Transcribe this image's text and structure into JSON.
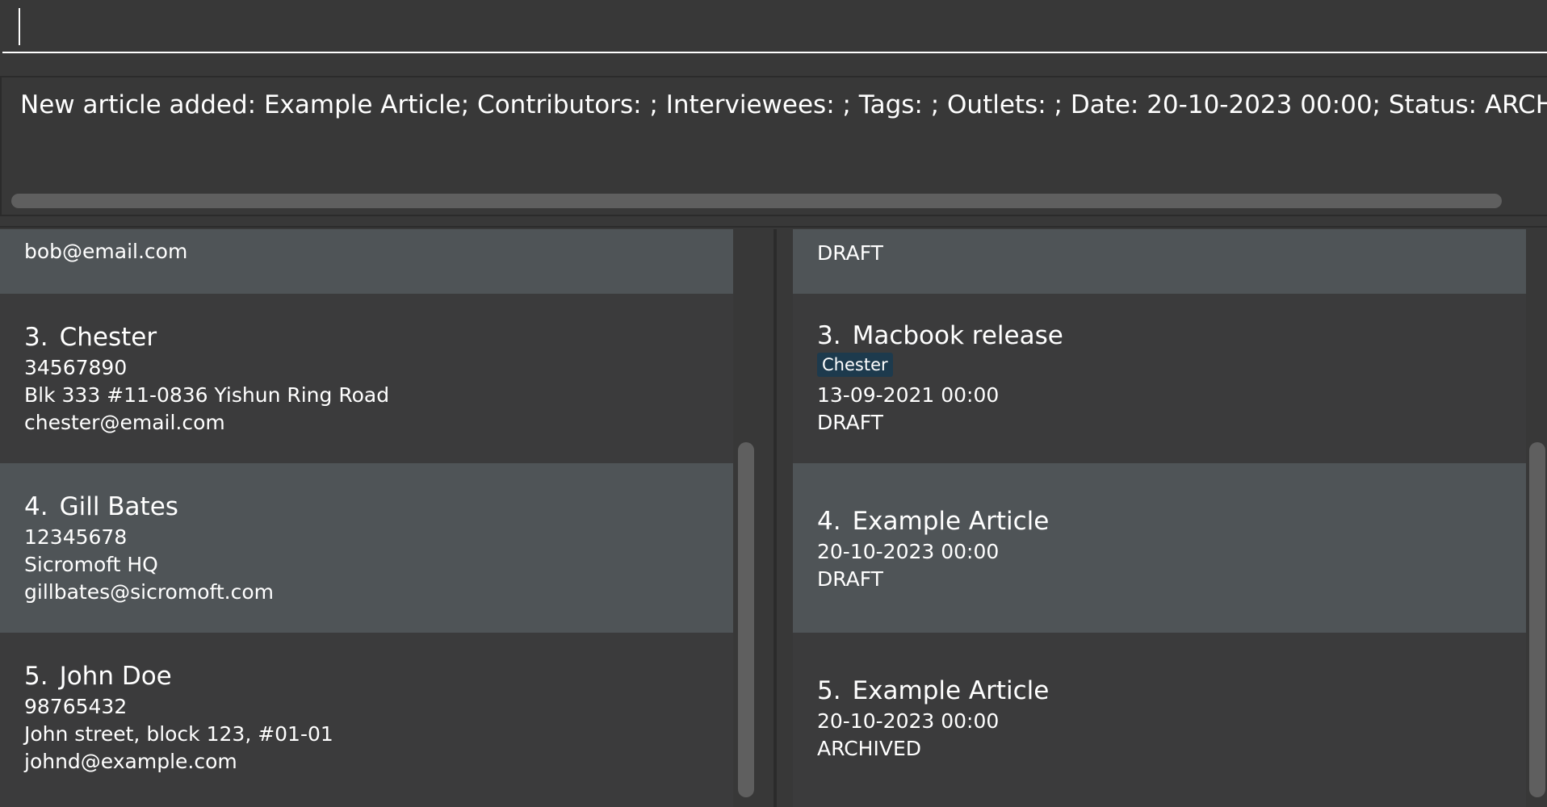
{
  "command": {
    "value": "",
    "placeholder": ""
  },
  "result": {
    "text": "New article added: Example Article; Contributors: ; Interviewees: ; Tags: ; Outlets: ; Date: 20-10-2023 00:00; Status: ARCHIVED; Lin"
  },
  "persons": [
    {
      "email": "bob@email.com"
    },
    {
      "index": "3.",
      "name": "Chester",
      "phone": "34567890",
      "address": "Blk 333 #11-0836 Yishun Ring Road",
      "email": "chester@email.com"
    },
    {
      "index": "4.",
      "name": "Gill Bates",
      "phone": "12345678",
      "address": "Sicromoft HQ",
      "email": "gillbates@sicromoft.com"
    },
    {
      "index": "5.",
      "name": "John Doe",
      "phone": "98765432",
      "address": "John street, block 123, #01-01",
      "email": "johnd@example.com"
    }
  ],
  "articles": [
    {
      "status": "DRAFT"
    },
    {
      "index": "3.",
      "title": "Macbook release",
      "tag": "Chester",
      "date": "13-09-2021 00:00",
      "status": "DRAFT"
    },
    {
      "index": "4.",
      "title": "Example Article",
      "date": "20-10-2023 00:00",
      "status": "DRAFT"
    },
    {
      "index": "5.",
      "title": "Example Article",
      "date": "20-10-2023 00:00",
      "status": "ARCHIVED"
    }
  ],
  "colors": {
    "background": "#383838",
    "card_alt": "#4f5457",
    "card_base": "#3b3b3c",
    "tag_bg": "#1d3a4d",
    "scrollbar": "#5f5f5f"
  }
}
